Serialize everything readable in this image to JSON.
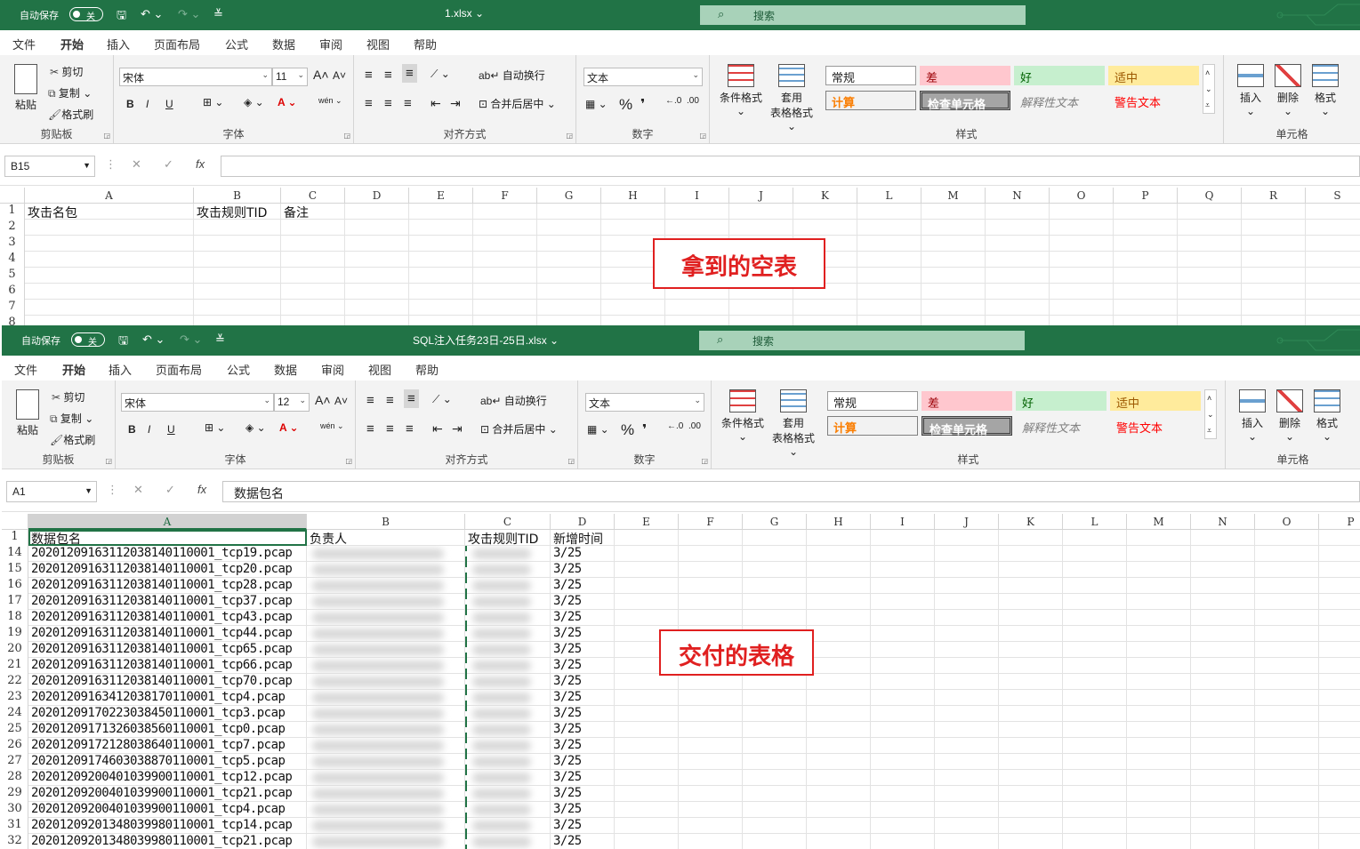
{
  "window1": {
    "autosave_label": "自动保存",
    "autosave_state": "关",
    "filename": "1.xlsx ⌄",
    "search": "搜索",
    "tabs": [
      "文件",
      "开始",
      "插入",
      "页面布局",
      "公式",
      "数据",
      "审阅",
      "视图",
      "帮助"
    ],
    "active_tab": "开始",
    "font_name": "宋体",
    "font_size": "11",
    "name_box": "B15",
    "formula": "",
    "columns": [
      "A",
      "B",
      "C",
      "D",
      "E",
      "F",
      "G",
      "H",
      "I",
      "J",
      "K",
      "L",
      "M",
      "N",
      "O",
      "P",
      "Q",
      "R",
      "S"
    ],
    "rows": [
      {
        "n": "1",
        "cells": [
          "攻击名包",
          "攻击规则TID",
          "备注"
        ]
      },
      {
        "n": "2",
        "cells": [
          "",
          "",
          ""
        ]
      },
      {
        "n": "3",
        "cells": [
          "",
          "",
          ""
        ]
      },
      {
        "n": "4",
        "cells": [
          "",
          "",
          ""
        ]
      },
      {
        "n": "5",
        "cells": [
          "",
          "",
          ""
        ]
      },
      {
        "n": "6",
        "cells": [
          "",
          "",
          ""
        ]
      },
      {
        "n": "7",
        "cells": [
          "",
          "",
          ""
        ]
      },
      {
        "n": "8",
        "cells": [
          "",
          "",
          ""
        ]
      }
    ],
    "annotation": "拿到的空表"
  },
  "window2": {
    "autosave_label": "自动保存",
    "autosave_state": "关",
    "filename": "SQL注入任务23日-25日.xlsx ⌄",
    "search": "搜索",
    "tabs": [
      "文件",
      "开始",
      "插入",
      "页面布局",
      "公式",
      "数据",
      "审阅",
      "视图",
      "帮助"
    ],
    "active_tab": "开始",
    "font_name": "宋体",
    "font_size": "12",
    "name_box": "A1",
    "formula": "数据包名",
    "columns": [
      "A",
      "B",
      "C",
      "D",
      "E",
      "F",
      "G",
      "H",
      "I",
      "J",
      "K",
      "L",
      "M",
      "N",
      "O",
      "P"
    ],
    "header_row": {
      "n": "1",
      "cells": [
        "数据包名",
        "负责人",
        "攻击规则TID",
        "新增时间"
      ]
    },
    "rows": [
      {
        "n": "14",
        "file": "20201209163112038140110001_tcp19.pcap",
        "date": "3/25"
      },
      {
        "n": "15",
        "file": "20201209163112038140110001_tcp20.pcap",
        "date": "3/25"
      },
      {
        "n": "16",
        "file": "20201209163112038140110001_tcp28.pcap",
        "date": "3/25"
      },
      {
        "n": "17",
        "file": "20201209163112038140110001_tcp37.pcap",
        "date": "3/25"
      },
      {
        "n": "18",
        "file": "20201209163112038140110001_tcp43.pcap",
        "date": "3/25"
      },
      {
        "n": "19",
        "file": "20201209163112038140110001_tcp44.pcap",
        "date": "3/25"
      },
      {
        "n": "20",
        "file": "20201209163112038140110001_tcp65.pcap",
        "date": "3/25"
      },
      {
        "n": "21",
        "file": "20201209163112038140110001_tcp66.pcap",
        "date": "3/25"
      },
      {
        "n": "22",
        "file": "20201209163112038140110001_tcp70.pcap",
        "date": "3/25"
      },
      {
        "n": "23",
        "file": "20201209163412038170110001_tcp4.pcap",
        "date": "3/25"
      },
      {
        "n": "24",
        "file": "20201209170223038450110001_tcp3.pcap",
        "date": "3/25"
      },
      {
        "n": "25",
        "file": "20201209171326038560110001_tcp0.pcap",
        "date": "3/25"
      },
      {
        "n": "26",
        "file": "20201209172128038640110001_tcp7.pcap",
        "date": "3/25"
      },
      {
        "n": "27",
        "file": "20201209174603038870110001_tcp5.pcap",
        "date": "3/25"
      },
      {
        "n": "28",
        "file": "20201209200401039900110001_tcp12.pcap",
        "date": "3/25"
      },
      {
        "n": "29",
        "file": "20201209200401039900110001_tcp21.pcap",
        "date": "3/25"
      },
      {
        "n": "30",
        "file": "20201209200401039900110001_tcp4.pcap",
        "date": "3/25"
      },
      {
        "n": "31",
        "file": "20201209201348039980110001_tcp14.pcap",
        "date": "3/25"
      },
      {
        "n": "32",
        "file": "20201209201348039980110001_tcp21.pcap",
        "date": "3/25"
      }
    ],
    "annotation": "交付的表格"
  },
  "ribbon": {
    "paste": "粘贴",
    "cut": "剪切",
    "copy": "复制",
    "format_painter": "格式刷",
    "clipboard": "剪贴板",
    "font": "字体",
    "wrap_text": "自动换行",
    "merge_center": "合并后居中",
    "alignment": "对齐方式",
    "number_format": "文本",
    "number": "数字",
    "conditional_format": "条件格式",
    "table_format_1": "套用",
    "table_format_2": "表格格式",
    "styles": "样式",
    "style_normal": "常规",
    "style_bad": "差",
    "style_good": "好",
    "style_neutral": "适中",
    "style_calc": "计算",
    "style_check": "检查单元格",
    "style_explain": "解释性文本",
    "style_warn": "警告文本",
    "insert": "插入",
    "delete": "删除",
    "format": "格式",
    "cells": "单元格",
    "fx": "fx",
    "bold": "B",
    "italic": "I",
    "underline": "U",
    "percent": "%",
    "comma": "❜"
  },
  "colors": {
    "title_green": "#217346",
    "annotation_red": "#e02020",
    "bad_bg": "#ffc7ce",
    "good_bg": "#c6efce",
    "neutral_bg": "#ffeb9c"
  }
}
